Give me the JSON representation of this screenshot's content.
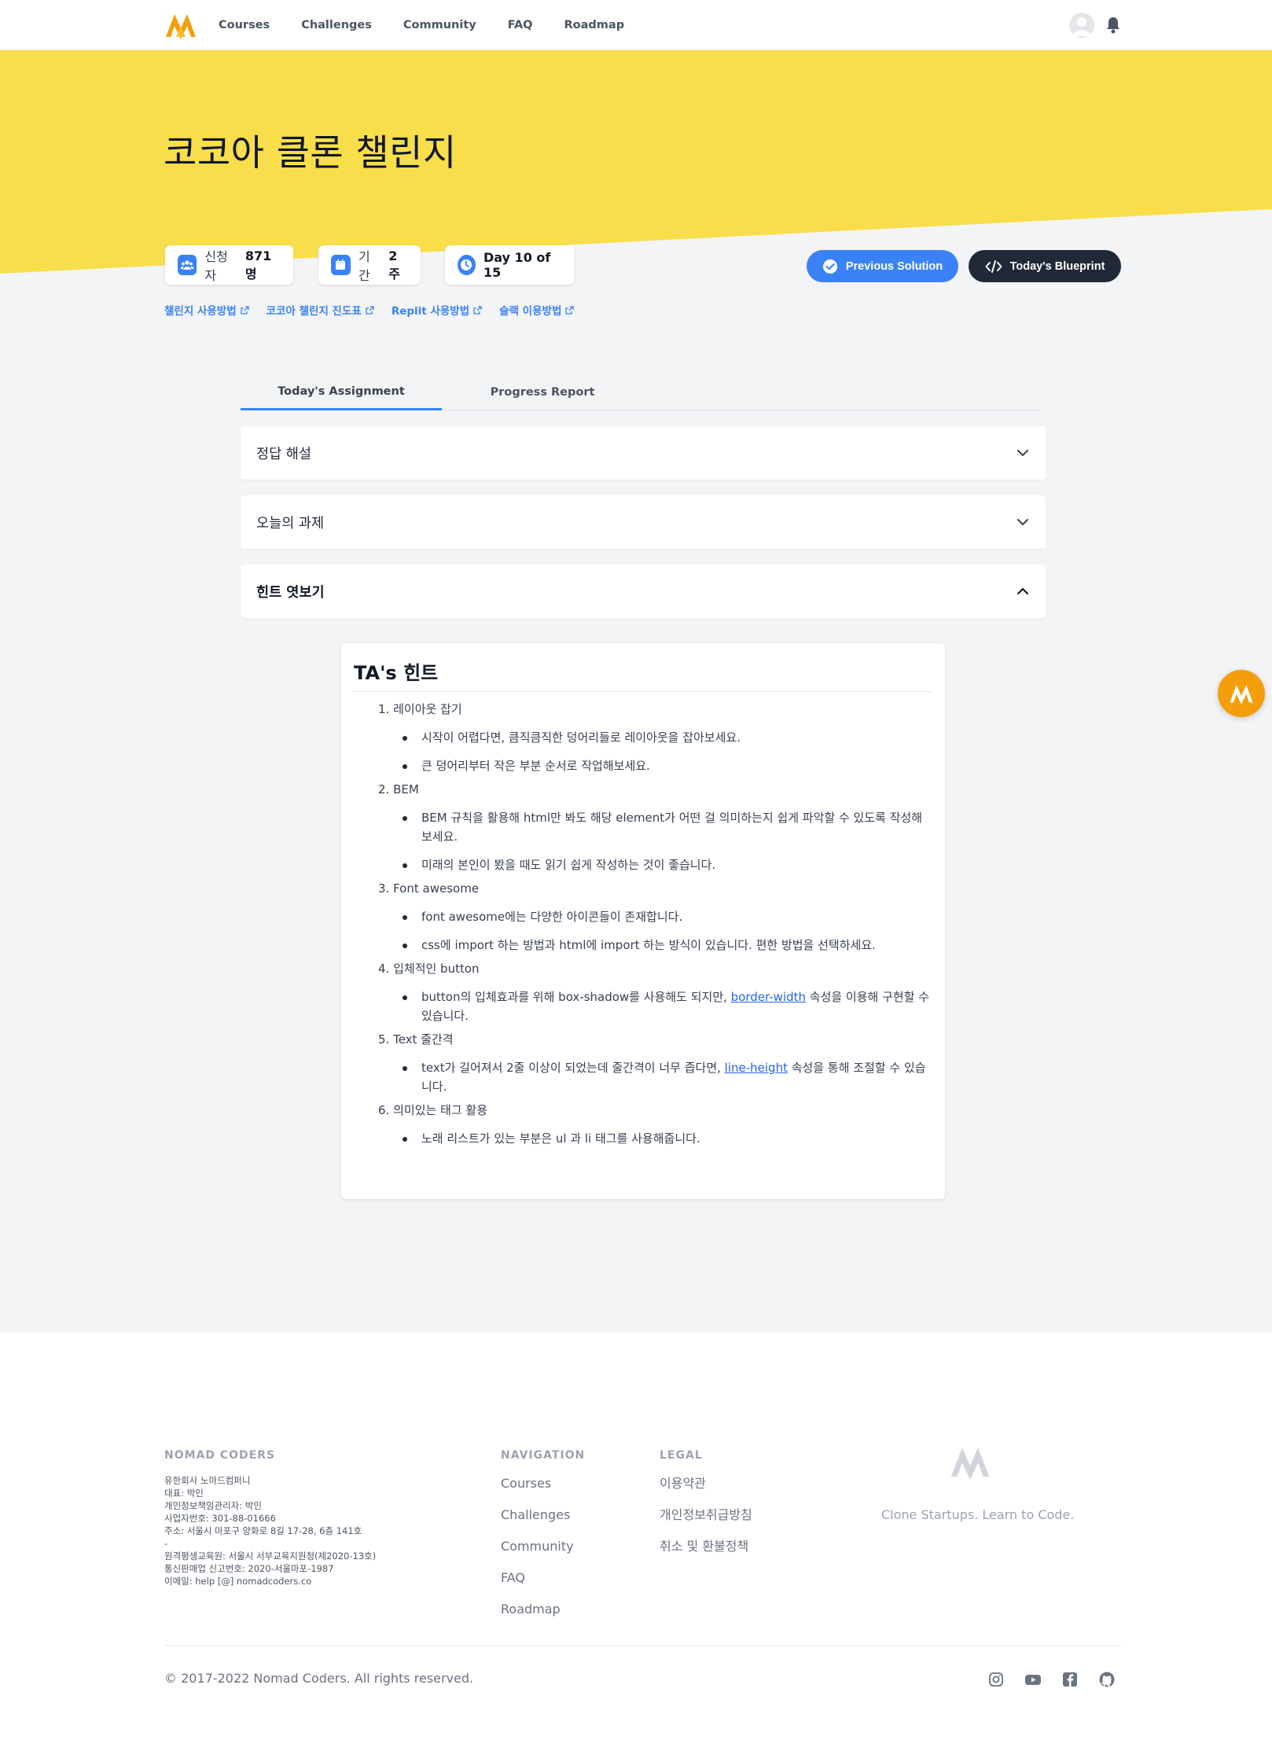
{
  "nav": {
    "links": [
      "Courses",
      "Challenges",
      "Community",
      "FAQ",
      "Roadmap"
    ]
  },
  "hero": {
    "title": "코코아 클론 챌린지"
  },
  "stats": {
    "applicants_label": "신청자",
    "applicants_value": "871명",
    "duration_label": "기간",
    "duration_value": "2주",
    "day_label": "Day 10 of 15"
  },
  "buttons": {
    "previous_solution": "Previous Solution",
    "todays_blueprint": "Today's Blueprint"
  },
  "help_links": [
    "챌린지 사용방법",
    "코코아 챌린지 진도표",
    "Replit 사용방법",
    "슬랙 이용방법"
  ],
  "tabs": [
    "Today's Assignment",
    "Progress Report"
  ],
  "accordion": [
    "정답 해설",
    "오늘의 과제",
    "힌트 엿보기"
  ],
  "hint": {
    "title": "TA's 힌트",
    "items": [
      {
        "num": "1.",
        "title": "레이아웃 잡기",
        "subs": [
          {
            "text": "시작이 어렵다면, 큼직큼직한 덩어리들로 레이아웃을 잡아보세요."
          },
          {
            "text": "큰 덩어리부터 작은 부분 순서로 작업해보세요."
          }
        ]
      },
      {
        "num": "2.",
        "title": "BEM",
        "subs": [
          {
            "text": "BEM 규칙을 활용해 html만 봐도 해당 element가 어떤 걸 의미하는지 쉽게 파악할 수 있도록 작성해보세요."
          },
          {
            "text": "미래의 본인이 봤을 때도 읽기 쉽게 작성하는 것이 좋습니다."
          }
        ]
      },
      {
        "num": "3.",
        "title": "Font awesome",
        "subs": [
          {
            "text": "font awesome에는 다양한 아이콘들이 존재합니다."
          },
          {
            "text": "css에 import 하는 방법과 html에 import 하는 방식이 있습니다. 편한 방법을 선택하세요."
          }
        ]
      },
      {
        "num": "4.",
        "title": "입체적인 button",
        "subs": [
          {
            "pre": "button의 입체효과를 위해 box-shadow를 사용해도 되지만, ",
            "link": "border-width",
            "post": " 속성을 이용해 구현할 수 있습니다."
          }
        ]
      },
      {
        "num": "5.",
        "title": "Text 줄간격",
        "subs": [
          {
            "pre": "text가 길어져서 2줄 이상이 되었는데 줄간격이 너무 좁다면, ",
            "link": "line-height",
            "post": " 속성을 통해 조절할 수 있습니다."
          }
        ]
      },
      {
        "num": "6.",
        "title": "의미있는 태그 활용",
        "subs": [
          {
            "text": "노래 리스트가 있는 부분은 ul 과 li 태그를 사용해줍니다."
          }
        ]
      }
    ]
  },
  "footer": {
    "company_heading": "NOMAD CODERS",
    "company_info": [
      "유한회사 노마드컴퍼니",
      "대표: 박인",
      "개인정보책임관리자: 박인",
      "사업자번호: 301-88-01666",
      "주소: 서울시 마포구 양화로 8길 17-28, 6층 141호",
      "-",
      "원격평생교육원: 서울시 서부교육지원청(제2020-13호)",
      "통신판매업 신고번호: 2020-서울마포-1987",
      "이메일: help [@] nomadcoders.co"
    ],
    "nav_heading": "NAVIGATION",
    "nav_links": [
      "Courses",
      "Challenges",
      "Community",
      "FAQ",
      "Roadmap"
    ],
    "legal_heading": "LEGAL",
    "legal_links": [
      "이용약관",
      "개인정보취급방침",
      "취소 및 환불정책"
    ],
    "tagline": "Clone Startups. Learn to Code.",
    "copyright": "© 2017-2022 Nomad Coders. All rights reserved.",
    "social": [
      "instagram-icon",
      "youtube-icon",
      "facebook-icon",
      "github-icon"
    ]
  },
  "colors": {
    "hero_yellow": "#f9de4c",
    "accent_blue": "#3b82f6",
    "dark": "#1f2937",
    "brand_orange": "#f59e0b"
  }
}
